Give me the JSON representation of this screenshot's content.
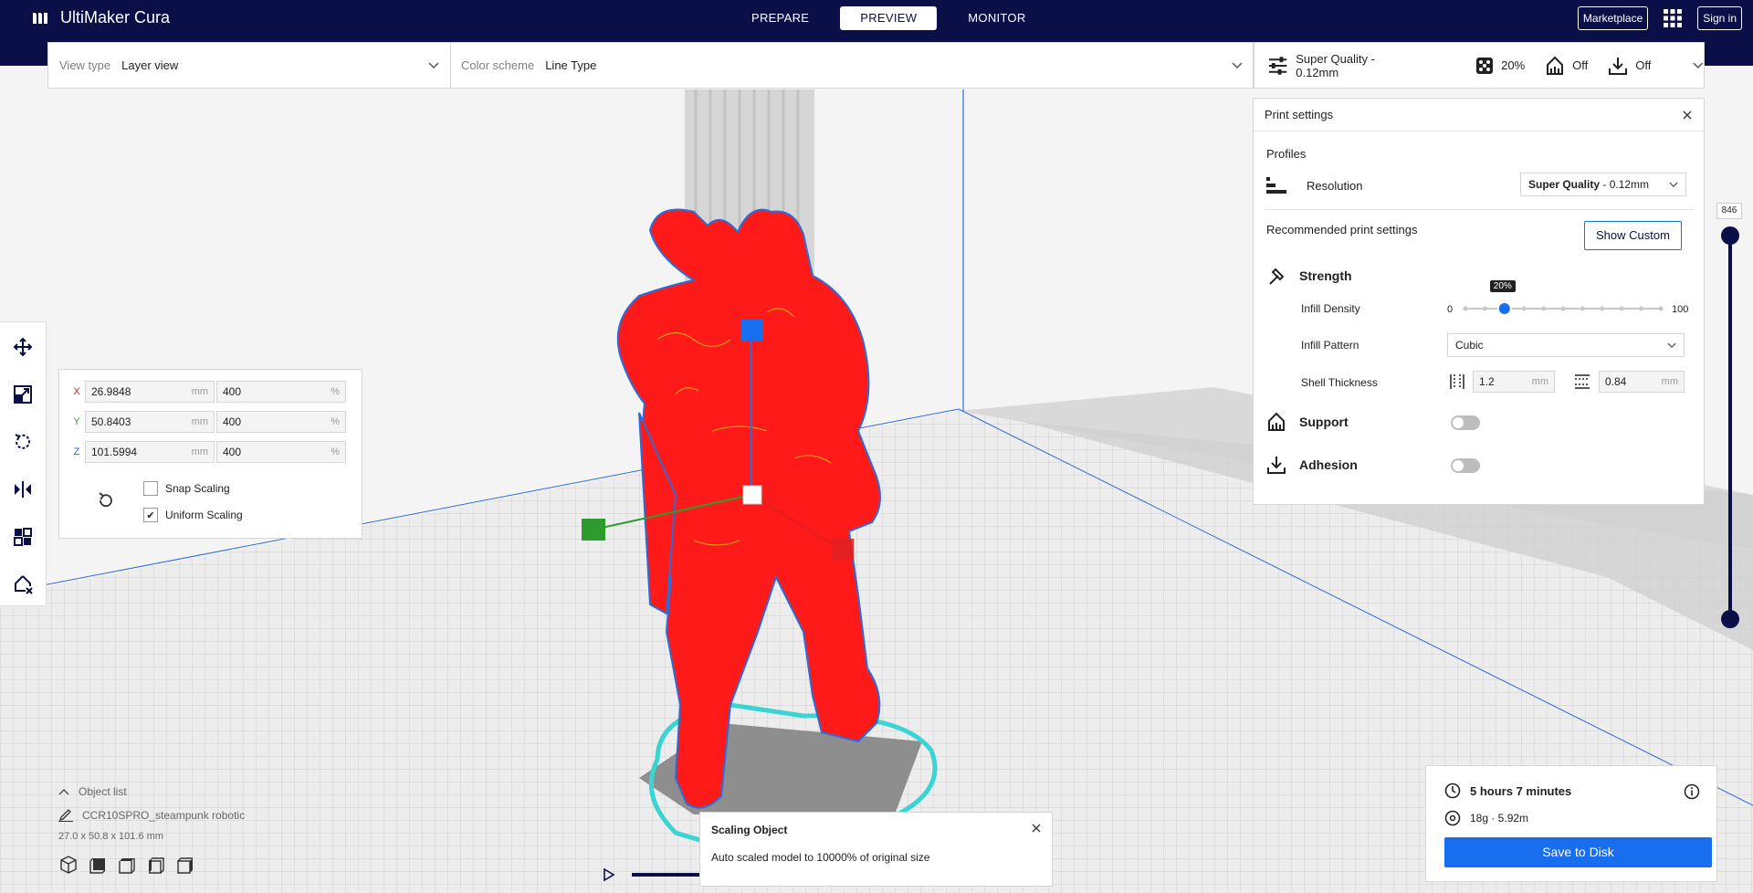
{
  "app": {
    "title": "UltiMaker Cura"
  },
  "stages": [
    {
      "label": "PREPARE",
      "active": false
    },
    {
      "label": "PREVIEW",
      "active": true
    },
    {
      "label": "MONITOR",
      "active": false
    }
  ],
  "top_right": {
    "marketplace": "Marketplace",
    "sign_in": "Sign in"
  },
  "viewbar": {
    "view_type_label": "View type",
    "view_type_value": "Layer view",
    "color_scheme_label": "Color scheme",
    "color_scheme_value": "Line Type"
  },
  "qualitybar": {
    "profile": "Super Quality - 0.12mm",
    "infill": "20%",
    "support": "Off",
    "adhesion": "Off"
  },
  "scale_panel": {
    "rows": [
      {
        "axis": "X",
        "axis_color": "#e02020",
        "mm": "26.9848",
        "mm_unit": "mm",
        "pct": "400",
        "pct_unit": "%"
      },
      {
        "axis": "Y",
        "axis_color": "#2e9b2e",
        "mm": "50.8403",
        "mm_unit": "mm",
        "pct": "400",
        "pct_unit": "%"
      },
      {
        "axis": "Z",
        "axis_color": "#196ef0",
        "mm": "101.5994",
        "mm_unit": "mm",
        "pct": "400",
        "pct_unit": "%"
      }
    ],
    "snap_scaling": "Snap Scaling",
    "snap_checked": false,
    "uniform_scaling": "Uniform Scaling",
    "uniform_checked": true
  },
  "print_settings": {
    "title": "Print settings",
    "profiles_label": "Profiles",
    "resolution_label": "Resolution",
    "resolution_value_bold": "Super Quality",
    "resolution_value_rest": " - 0.12mm",
    "recommended_label": "Recommended print settings",
    "show_custom": "Show Custom",
    "strength_label": "Strength",
    "infill_density_label": "Infill Density",
    "infill_min": "0",
    "infill_max": "100",
    "infill_value": 20,
    "infill_tooltip": "20%",
    "infill_pattern_label": "Infill Pattern",
    "infill_pattern_value": "Cubic",
    "shell_thickness_label": "Shell Thickness",
    "wall_thickness": "1.2",
    "top_bottom_thickness": "0.84",
    "unit_mm": "mm",
    "support_label": "Support",
    "support_on": false,
    "adhesion_label": "Adhesion",
    "adhesion_on": false
  },
  "layer_slider": {
    "max_layer": "846"
  },
  "object_list": {
    "header": "Object list",
    "item": "CCR10SPRO_steampunk robotic",
    "dimensions": "27.0 x 50.8 x 101.6 mm"
  },
  "toast": {
    "title": "Scaling Object",
    "message": "Auto scaled model to 10000% of original size"
  },
  "estimate": {
    "time": "5 hours 7 minutes",
    "material": "18g · 5.92m",
    "save_button": "Save to Disk"
  },
  "colors": {
    "topbar": "#0a0f47",
    "accent": "#196ef0",
    "model": "#ff1a1a",
    "skirt": "#3bd4d4"
  }
}
